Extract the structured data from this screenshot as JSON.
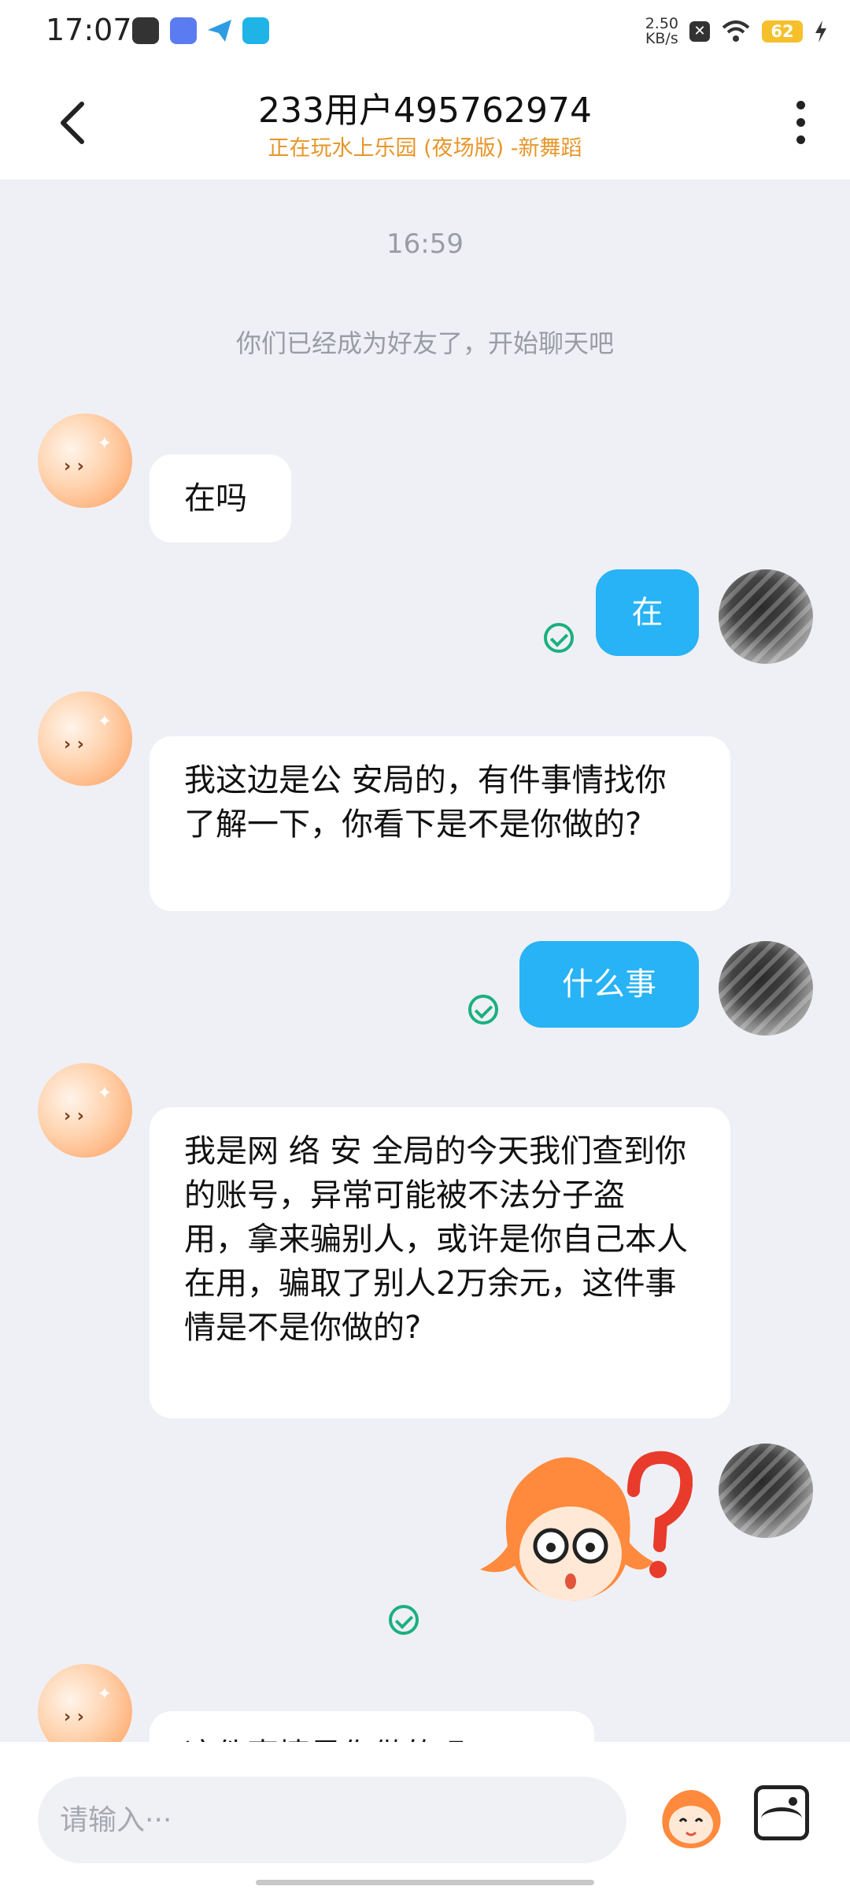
{
  "status_bar": {
    "time": "17:07",
    "net_speed_value": "2.50",
    "net_speed_unit": "KB/s",
    "battery": "62",
    "icons": [
      "notification-icon",
      "app-icon",
      "paper-plane-icon",
      "browser-icon",
      "wifi-icon",
      "charging-icon"
    ]
  },
  "header": {
    "title": "233用户495762974",
    "subtitle": "正在玩水上乐园 (夜场版) -新舞蹈"
  },
  "chat": {
    "timestamp": "16:59",
    "system_message": "你们已经成为好友了，开始聊天吧",
    "messages": [
      {
        "from": "them",
        "text": "在吗"
      },
      {
        "from": "me",
        "text": "在",
        "status": "sent"
      },
      {
        "from": "them",
        "text": "我这边是公  安局的，有件事情找你了解一下，你看下是不是你做的?"
      },
      {
        "from": "me",
        "text": "什么事",
        "status": "sent"
      },
      {
        "from": "them",
        "text": "我是网  络  安  全局的今天我们查到你的账号，异常可能被不法分子盗  用，拿来骗别人，或许是你自己本人在用，骗取了别人2万余元，这件事情是不是你做的?"
      },
      {
        "from": "me",
        "sticker": "confused-question-sticker",
        "status": "sent"
      },
      {
        "from": "them",
        "text": "这件事情是你做的吗?"
      }
    ]
  },
  "input": {
    "placeholder": "请输入···"
  },
  "colors": {
    "accent_blue": "#27b3f5",
    "subtitle_orange": "#e6962a",
    "check_green": "#1bb07e",
    "chat_bg": "#eff0f6"
  }
}
